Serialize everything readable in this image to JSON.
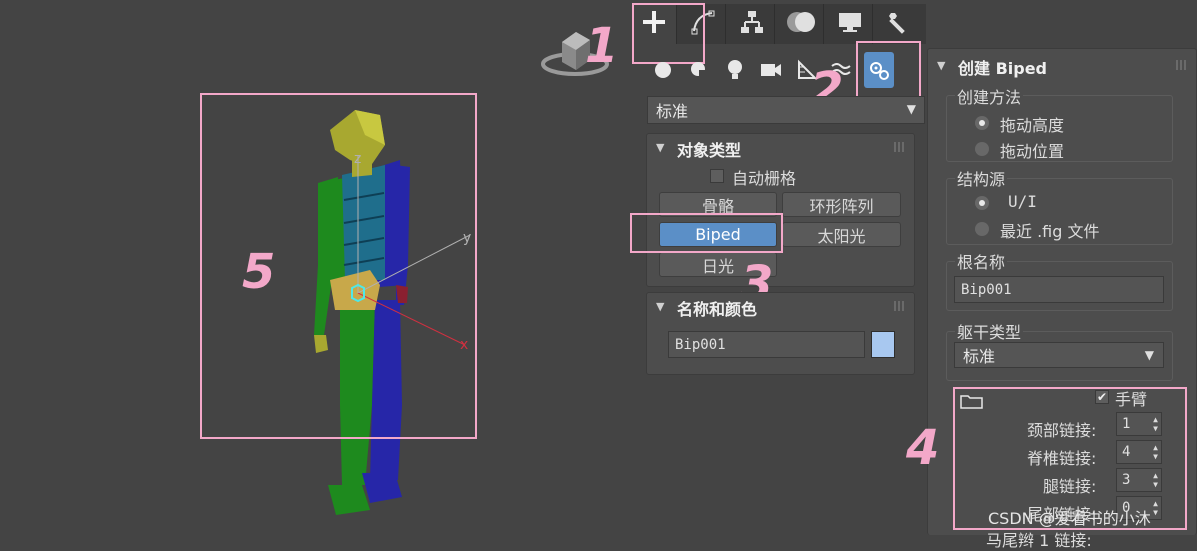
{
  "tabs": [
    {
      "name": "create-tab",
      "icon": "plus-icon",
      "active": true
    },
    {
      "name": "modify-tab",
      "icon": "curve-icon",
      "active": false
    },
    {
      "name": "hierarchy-tab",
      "icon": "hierarchy-icon",
      "active": false
    },
    {
      "name": "motion-tab",
      "icon": "motion-icon",
      "active": false
    },
    {
      "name": "display-tab",
      "icon": "monitor-icon",
      "active": false
    },
    {
      "name": "utilities-tab",
      "icon": "wrench-icon",
      "active": false
    }
  ],
  "subcategories": [
    "geometry-icon",
    "shapes-icon",
    "lights-icon",
    "cameras-icon",
    "helpers-icon",
    "spacewarps-icon",
    "systems-icon"
  ],
  "category_dropdown": "标准",
  "object_type": {
    "title": "对象类型",
    "autogrid_label": "自动栅格",
    "buttons": [
      "骨骼",
      "环形阵列",
      "Biped",
      "太阳光",
      "日光"
    ],
    "active": "Biped"
  },
  "name_color": {
    "title": "名称和颜色",
    "name_value": "Bip001",
    "swatch_color": "#a8c8f0"
  },
  "create_biped": {
    "title": "创建 Biped",
    "creation_method": {
      "label": "创建方法",
      "options": [
        "拖动高度",
        "拖动位置"
      ],
      "selected": 0
    },
    "structure_source": {
      "label": "结构源",
      "options": [
        "U/I",
        "最近 .fig 文件"
      ],
      "selected": 0
    },
    "root_name": {
      "label": "根名称",
      "value": "Bip001"
    },
    "body_type": {
      "label": "躯干类型",
      "value": "标准"
    },
    "arms_label": "手臂",
    "neck_links": {
      "label": "颈部链接:",
      "value": "1"
    },
    "spine_links": {
      "label": "脊椎链接:",
      "value": "4"
    },
    "leg_links": {
      "label": "腿链接:",
      "value": "3"
    },
    "tail_links": {
      "label": "尾部链接:",
      "value": "0"
    },
    "ponytail_label": "马尾辫 1 链接:"
  },
  "viewport": {
    "axis_labels": {
      "x": "x",
      "y": "y",
      "z": "z"
    },
    "viewcube_icon": "viewcube-icon"
  },
  "annotations": [
    "1",
    "2",
    "3",
    "4",
    "5"
  ],
  "watermark": "CSDN @爱看书的小沐",
  "colors": {
    "accent": "#5b8fc7",
    "annotation": "#f3a8c9",
    "biped_green": "#1e8a1e",
    "biped_blue": "#2626a8",
    "biped_teal": "#1f6e8c",
    "biped_yellow": "#a8a830"
  }
}
